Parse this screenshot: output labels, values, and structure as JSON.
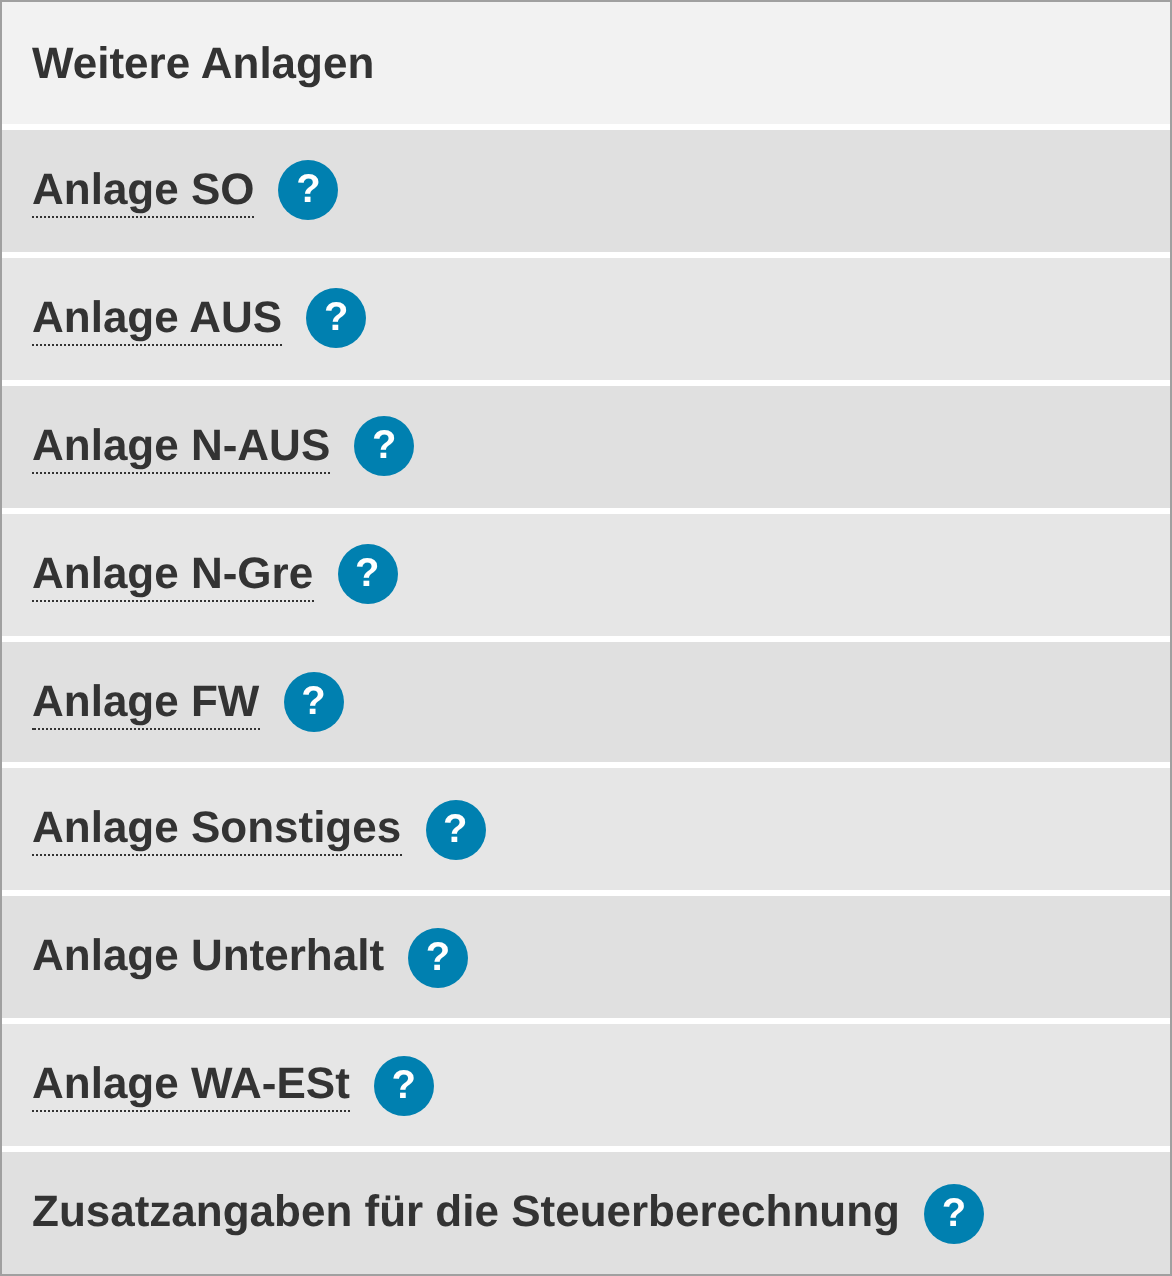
{
  "header": {
    "title": "Weitere Anlagen"
  },
  "items": [
    {
      "label": "Anlage SO",
      "dotted_underline": true,
      "help": "?"
    },
    {
      "label": "Anlage AUS",
      "dotted_underline": true,
      "help": "?"
    },
    {
      "label": "Anlage N-AUS",
      "dotted_underline": true,
      "help": "?"
    },
    {
      "label": "Anlage N-Gre",
      "dotted_underline": true,
      "help": "?"
    },
    {
      "label": "Anlage FW",
      "dotted_underline": true,
      "help": "?"
    },
    {
      "label": "Anlage Sonstiges",
      "dotted_underline": true,
      "help": "?"
    },
    {
      "label": "Anlage Unterhalt",
      "dotted_underline": false,
      "help": "?"
    },
    {
      "label": "Anlage WA-ESt",
      "dotted_underline": true,
      "help": "?"
    },
    {
      "label": "Zusatzangaben für die Steuerberechnung",
      "dotted_underline": false,
      "help": "?"
    }
  ]
}
